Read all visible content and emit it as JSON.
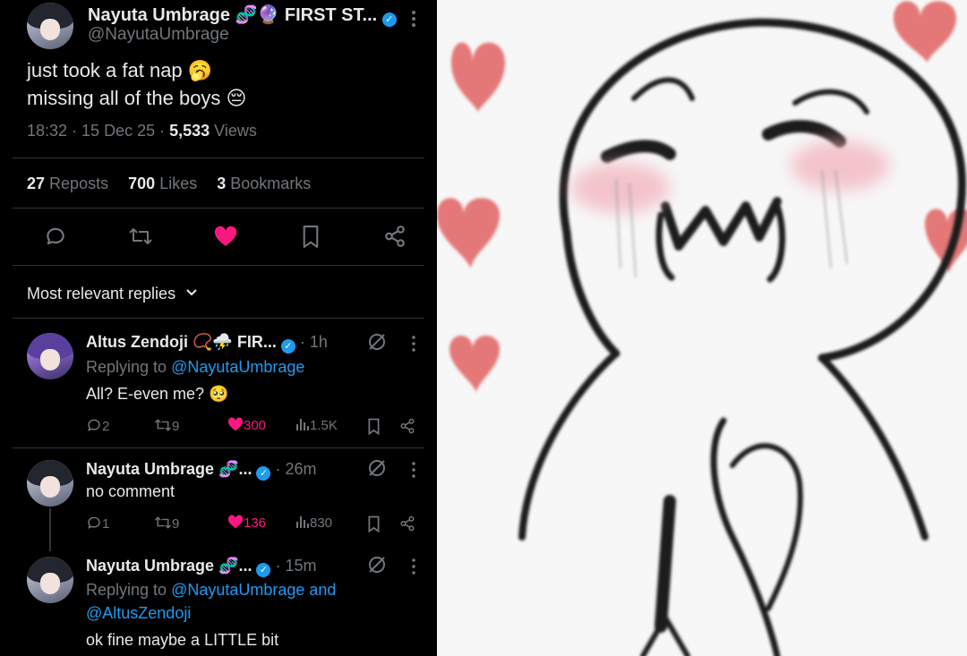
{
  "main_tweet": {
    "display_name": "Nayuta Umbrage 🧬🔮 FIRST ST...",
    "handle": "@NayutaUmbrage",
    "line1": "just took a fat nap 🥱",
    "line2": "missing all of the boys 😔",
    "time": "18:32 · 15 Dec 25 ·",
    "views_count": "5,533",
    "views_label": "Views",
    "reposts_count": "27",
    "reposts_label": "Reposts",
    "likes_count": "700",
    "likes_label": "Likes",
    "bookmarks_count": "3",
    "bookmarks_label": "Bookmarks"
  },
  "replies_header": "Most relevant replies",
  "replies": [
    {
      "display_name": "Altus Zendoji 📿⛈️ FIR...",
      "time": "· 1h",
      "replying_prefix": "Replying to",
      "replying_to": "@NayutaUmbrage",
      "text": "All? E-even me? 🥺",
      "comments": "2",
      "reposts": "9",
      "likes": "300",
      "views": "1.5K"
    },
    {
      "display_name": "Nayuta Umbrage 🧬...",
      "time": "· 26m",
      "text": "no comment",
      "comments": "1",
      "reposts": "9",
      "likes": "136",
      "views": "830"
    },
    {
      "display_name": "Nayuta Umbrage 🧬...",
      "time": "· 15m",
      "replying_prefix": "Replying to",
      "replying_to": "@NayutaUmbrage and",
      "replying_to_2": "@AltusZendoji",
      "text": "ok fine maybe a LITTLE bit"
    }
  ],
  "colors": {
    "background": "#000000",
    "text": "#e7e9ea",
    "muted": "#71767b",
    "link": "#1d9bf0",
    "like": "#f91880"
  },
  "icons": [
    "more-icon",
    "verified-icon",
    "reply-icon",
    "repost-icon",
    "like-icon",
    "bookmark-icon",
    "share-icon",
    "grok-icon",
    "views-icon",
    "chevron-down-icon"
  ],
  "meme_image": {
    "subject": "crying-blushing-doodle-with-hearts"
  }
}
